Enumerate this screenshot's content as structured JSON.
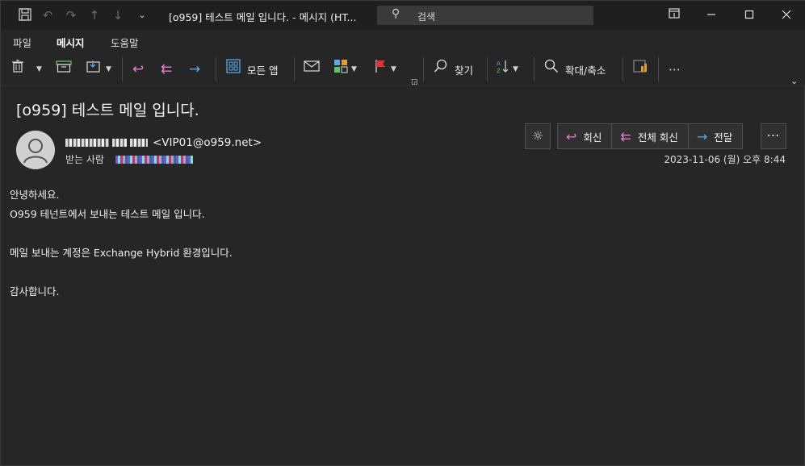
{
  "window": {
    "title": "[o959] 테스트 메일 입니다.  -  메시지 (HT...",
    "search_placeholder": "검색"
  },
  "titlebar_icons": [
    "save-icon",
    "undo-icon",
    "redo-icon",
    "up-icon",
    "down-icon",
    "customize-icon"
  ],
  "window_controls": [
    "pin-icon",
    "minimize-icon",
    "maximize-icon",
    "close-icon"
  ],
  "tabs": [
    {
      "label": "파일"
    },
    {
      "label": "메시지"
    },
    {
      "label": "도움말"
    }
  ],
  "ribbon": {
    "all_apps_label": "모든 앱",
    "find_label": "찾기",
    "zoom_label": "확대/축소"
  },
  "message": {
    "subject": "[o959] 테스트 메일 입니다.",
    "sender_email": "<VIP01@o959.net>",
    "to_label": "받는 사람",
    "date": "2023-11-06 (월) 오후 8:44",
    "actions": {
      "reply": "회신",
      "reply_all": "전체 회신",
      "forward": "전달"
    },
    "body": [
      "안녕하세요.",
      "O959 테넌트에서 보내는 테스트 메일 입니다.",
      "",
      "메일 보내는 계정은 Exchange Hybrid 환경입니다.",
      "",
      "감사합니다."
    ]
  },
  "colors": {
    "background": "#262626",
    "titlebar": "#1f1f1f",
    "reply_accent": "#e97ad1",
    "forward_accent": "#5aa8e8",
    "flag_red": "#e0303a"
  }
}
